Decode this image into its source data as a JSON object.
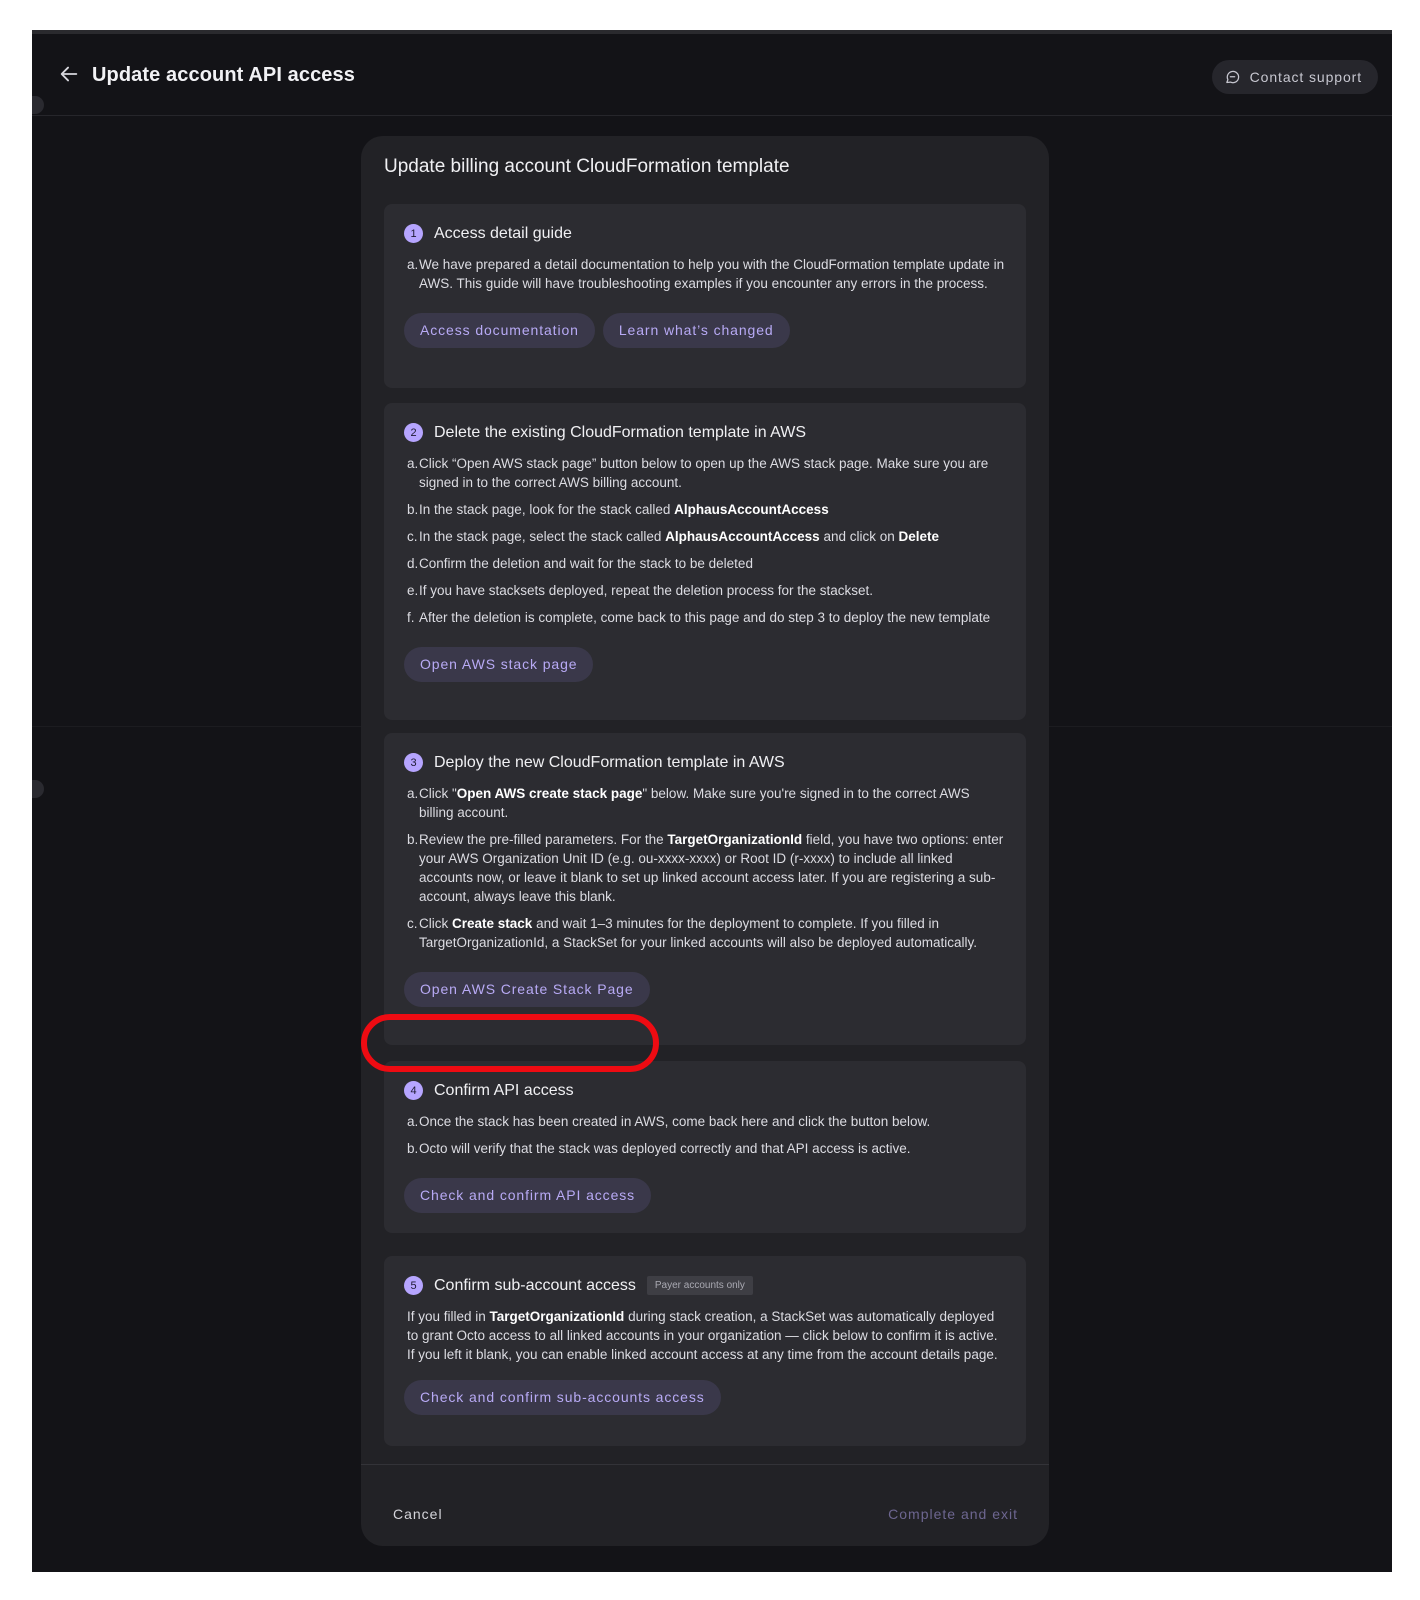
{
  "header": {
    "title": "Update account API access",
    "support_label": "Contact support"
  },
  "modal": {
    "title": "Update billing account CloudFormation template",
    "steps": [
      {
        "num": "1",
        "title": "Access detail guide",
        "items": [
          {
            "mark": "a.",
            "text": "We have prepared a detail documentation to help you with the CloudFormation template update in AWS. This guide will have troubleshooting examples if you encounter any errors in the process."
          }
        ],
        "buttons": [
          "Access documentation",
          "Learn what’s changed"
        ]
      },
      {
        "num": "2",
        "title": "Delete the existing CloudFormation template in AWS",
        "items": [
          {
            "mark": "a.",
            "text": "Click “Open AWS stack page” button below to open up the AWS stack page. Make sure you are signed in to the correct AWS billing account."
          },
          {
            "mark": "b.",
            "pre": "In the stack page, look for the stack called ",
            "bold": "AlphausAccountAccess"
          },
          {
            "mark": "c.",
            "pre": "In the stack page, select the stack called ",
            "bold": "AlphausAccountAccess",
            "mid": " and click on ",
            "bold2": "Delete"
          },
          {
            "mark": "d.",
            "text": "Confirm the deletion and wait for the stack to be deleted"
          },
          {
            "mark": "e.",
            "text": "If you have stacksets deployed, repeat the deletion process for the stackset."
          },
          {
            "mark": "f.",
            "text": "After the deletion is complete, come back to this page and do step 3 to deploy the new template"
          }
        ],
        "buttons": [
          "Open AWS stack page"
        ]
      },
      {
        "num": "3",
        "title": "Deploy the new CloudFormation template in AWS",
        "items": [
          {
            "mark": "a.",
            "pre": "Click \"",
            "bold": "Open AWS create stack page",
            "post": "\" below. Make sure you're signed in to the correct AWS billing account."
          },
          {
            "mark": "b.",
            "pre": "Review the pre-filled parameters. For the ",
            "bold": "TargetOrganizationId",
            "post": " field, you have two options: enter your AWS Organization Unit ID (e.g. ou-xxxx-xxxx) or Root ID (r-xxxx) to include all linked accounts now, or leave it blank to set up linked account access later. If you are registering a sub-account, always leave this blank."
          },
          {
            "mark": "c.",
            "pre": "Click ",
            "bold": "Create stack",
            "post": " and wait 1–3 minutes for the deployment to complete. If you filled in TargetOrganizationId, a StackSet for your linked accounts will also be deployed automatically."
          }
        ],
        "buttons": [
          "Open AWS Create Stack Page"
        ]
      },
      {
        "num": "4",
        "title": "Confirm API access",
        "items": [
          {
            "mark": "a.",
            "text": "Once the stack has been created in AWS, come back here and click the button below."
          },
          {
            "mark": "b.",
            "text": "Octo will verify that the stack was deployed correctly and that API access is active."
          }
        ],
        "buttons": [
          "Check and confirm API access"
        ]
      },
      {
        "num": "5",
        "title": "Confirm sub-account access",
        "badge": "Payer accounts only",
        "para_pre": "If you filled in ",
        "para_bold": "TargetOrganizationId",
        "para_post": " during stack creation, a StackSet was automatically deployed to grant Octo access to all linked accounts in your organization — click below to confirm it is active. If you left it blank, you can enable linked account access at any time from the account details page.",
        "buttons": [
          "Check and confirm sub-accounts access"
        ]
      }
    ],
    "footer": {
      "cancel": "Cancel",
      "complete": "Complete and exit"
    }
  },
  "colors": {
    "accent": "#b8aaf5",
    "highlight": "#ee0b12",
    "background": "#131317"
  }
}
